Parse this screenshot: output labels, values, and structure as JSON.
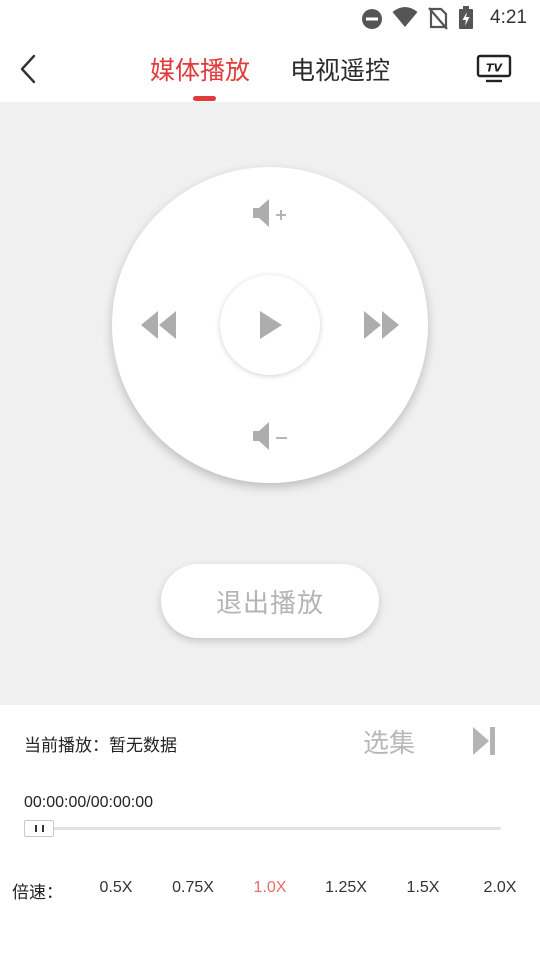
{
  "status_bar": {
    "time": "4:21",
    "icons": [
      "do-not-disturb-icon",
      "wifi-icon",
      "no-sim-icon",
      "battery-charging-icon"
    ]
  },
  "header": {
    "back_icon": "chevron-left-icon",
    "tabs": [
      {
        "label": "媒体播放",
        "active": true
      },
      {
        "label": "电视遥控",
        "active": false
      }
    ],
    "tv_icon": "tv-icon",
    "tv_icon_label": "TV"
  },
  "controls": {
    "volume_up_icon": "volume-up-icon",
    "volume_down_icon": "volume-down-icon",
    "rewind_icon": "rewind-icon",
    "forward_icon": "fast-forward-icon",
    "play_icon": "play-icon",
    "exit_label": "退出播放"
  },
  "now_playing": {
    "text": "当前播放：暂无数据",
    "episodes_label": "选集",
    "next_icon": "skip-next-icon"
  },
  "progress": {
    "time": "00:00:00/00:00:00",
    "position_fraction": 0
  },
  "speed": {
    "label": "倍速：",
    "options": [
      "0.5X",
      "0.75X",
      "1.0X",
      "1.25X",
      "1.5X",
      "2.0X"
    ],
    "selected": "1.0X"
  },
  "colors": {
    "accent": "#e23a3a",
    "selected_speed": "#ee6a6a",
    "panel_bg": "#f0f0f0",
    "disabled_text": "#b4b4b4"
  }
}
